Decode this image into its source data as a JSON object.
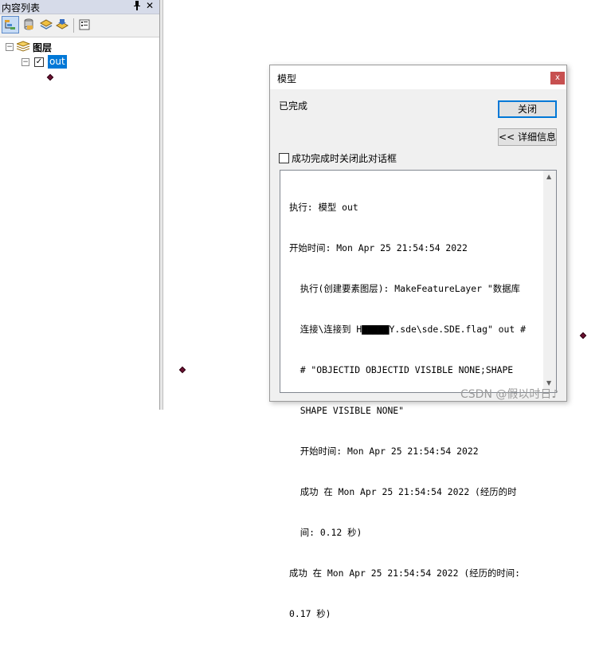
{
  "toc": {
    "title": "内容列表",
    "pin_glyph": "ᵖ",
    "close_glyph": "✕",
    "root_label": "图层",
    "layer_name": "out",
    "checkbox_glyph": "✓",
    "expander_glyph": "−"
  },
  "dialog": {
    "title": "模型",
    "close_glyph": "x",
    "status": "已完成",
    "close_button_label": "关闭",
    "details_button_label": "<< 详细信息",
    "auto_close_label": "成功完成时关闭此对话框",
    "log_lines": [
      "执行: 模型 out",
      "开始时间: Mon Apr 25 21:54:54 2022",
      "  执行(创建要素图层): MakeFeatureLayer \"数据库",
      "  连接\\连接到 H▇▇▇▇▇Y.sde\\sde.SDE.flag\" out #",
      "  # \"OBJECTID OBJECTID VISIBLE NONE;SHAPE",
      "  SHAPE VISIBLE NONE\"",
      "  开始时间: Mon Apr 25 21:54:54 2022",
      "  成功 在 Mon Apr 25 21:54:54 2022 (经历的时",
      "  间: 0.12 秒)",
      "成功 在 Mon Apr 25 21:54:54 2022 (经历的时间:",
      "0.17 秒)"
    ]
  },
  "watermark": "CSDN @假以时日♪"
}
